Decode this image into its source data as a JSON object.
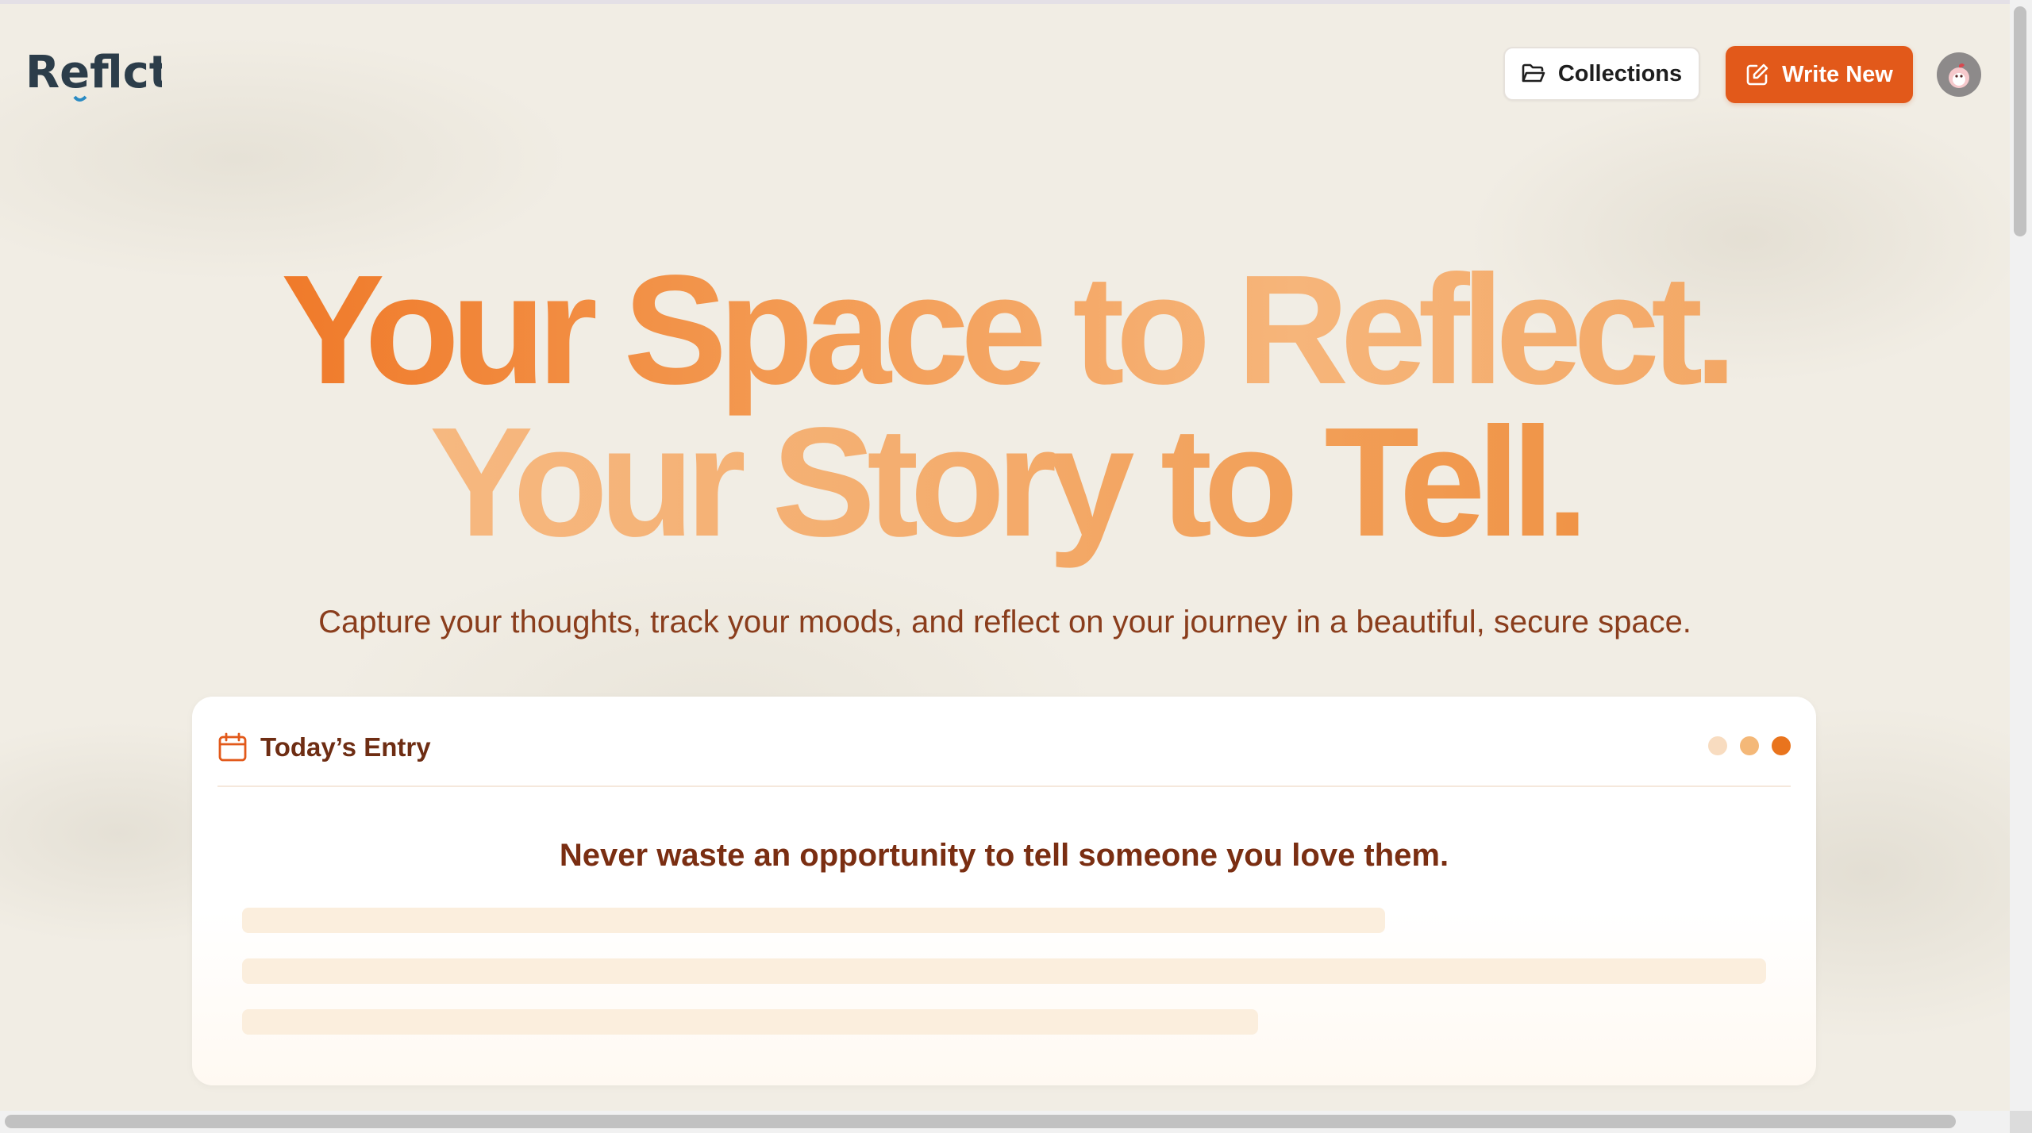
{
  "header": {
    "logo_text": "Reflct",
    "collections_label": "Collections",
    "write_new_label": "Write New"
  },
  "hero": {
    "line1": "Your Space to Reflect.",
    "line2": "Your Story to Tell.",
    "subtitle": "Capture your thoughts, track your moods, and reflect on your journey in a beautiful, secure space."
  },
  "entry_card": {
    "title": "Today’s Entry",
    "quote": "Never waste an opportunity to tell someone you love them.",
    "dot_colors": [
      "#f8dcc0",
      "#f4b878",
      "#e9741d"
    ]
  },
  "colors": {
    "accent": "#e2591a",
    "heading_gradient_start": "#f07a2a",
    "heading_gradient_end": "#f6b57a",
    "text_brown": "#8a3d1c"
  },
  "icons": {
    "collections": "folder-open-icon",
    "write_new": "pencil-square-icon",
    "entry_header": "calendar-icon",
    "avatar": "user-avatar"
  }
}
